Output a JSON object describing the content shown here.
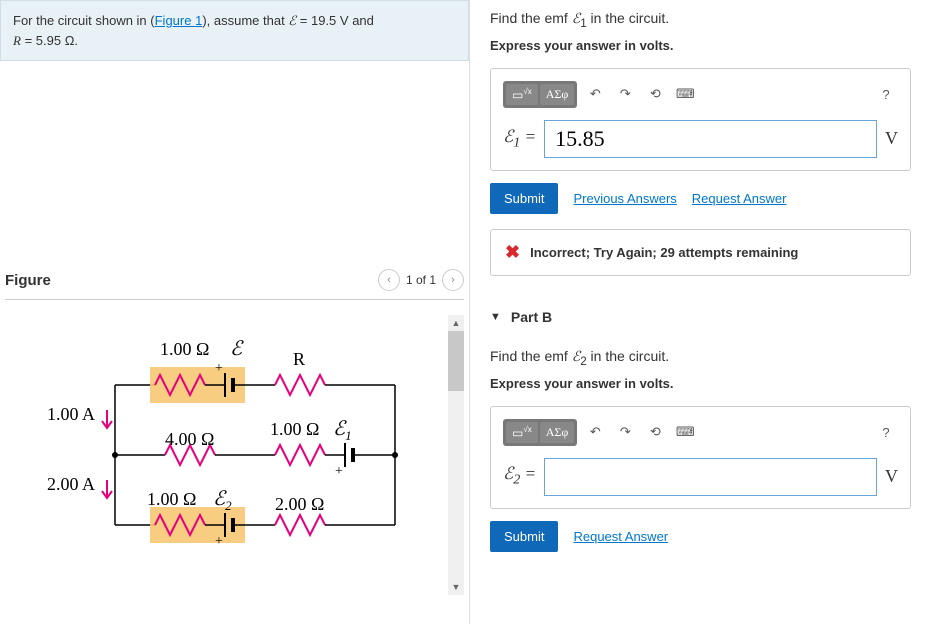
{
  "problem": {
    "prefix": "For the circuit shown in (",
    "figure_link": "Figure 1",
    "middle": "), assume that ",
    "emf_sym": "ℰ",
    "emf_eq": " = 19.5 ",
    "emf_unit": "V",
    "and": " and",
    "R_sym": "R",
    "R_eq": " = 5.95 ",
    "R_unit": "Ω",
    "end": "."
  },
  "figure": {
    "title": "Figure",
    "pager": "1 of 1",
    "labels": {
      "top_res": "1.00 Ω",
      "top_emf": "ℰ",
      "R": "R",
      "left_I1": "1.00 A",
      "mid_res": "4.00 Ω",
      "mid_right_res": "1.00 Ω",
      "mid_emf": "ℰ",
      "mid_emf_sub": "1",
      "left_I2": "2.00 A",
      "bot_res": "1.00 Ω",
      "bot_emf": "ℰ",
      "bot_emf_sub": "2",
      "bot_right_res": "2.00 Ω",
      "plus": "+"
    }
  },
  "partA": {
    "prompt_pre": "Find the emf ",
    "prompt_sym": "ℰ",
    "prompt_sub": "1",
    "prompt_post": " in the circuit.",
    "sub": "Express your answer in volts.",
    "toolbar_symbols": "ΑΣφ",
    "label_sym": "ℰ",
    "label_sub": "1",
    "label_eq": " = ",
    "value": "15.85",
    "unit": "V",
    "submit": "Submit",
    "prev": "Previous Answers",
    "req": "Request Answer",
    "feedback": "Incorrect; Try Again; 29 attempts remaining"
  },
  "partB": {
    "header": "Part B",
    "prompt_pre": "Find the emf ",
    "prompt_sym": "ℰ",
    "prompt_sub": "2",
    "prompt_post": " in the circuit.",
    "sub": "Express your answer in volts.",
    "toolbar_symbols": "ΑΣφ",
    "label_sym": "ℰ",
    "label_sub": "2",
    "label_eq": " = ",
    "value": "",
    "unit": "V",
    "submit": "Submit",
    "req": "Request Answer"
  },
  "help": "?"
}
